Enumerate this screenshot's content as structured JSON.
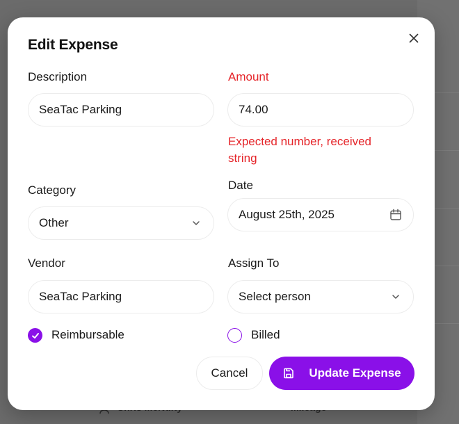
{
  "modal": {
    "title": "Edit Expense",
    "close_icon": "close-icon"
  },
  "form": {
    "description": {
      "label": "Description",
      "value": "SeaTac Parking"
    },
    "amount": {
      "label": "Amount",
      "value": "74.00",
      "error": "Expected number, received string"
    },
    "category": {
      "label": "Category",
      "value": "Other",
      "icon": "chevron-down-icon"
    },
    "date": {
      "label": "Date",
      "value": "August 25th, 2025",
      "icon": "calendar-icon"
    },
    "vendor": {
      "label": "Vendor",
      "value": "SeaTac Parking"
    },
    "assign_to": {
      "label": "Assign To",
      "value": "Select person",
      "icon": "chevron-down-icon"
    },
    "reimbursable": {
      "label": "Reimbursable",
      "checked": true
    },
    "billed": {
      "label": "Billed",
      "checked": false
    }
  },
  "actions": {
    "cancel_label": "Cancel",
    "update_label": "Update Expense",
    "update_icon": "save-icon"
  },
  "background": {
    "footer_name": "Chris McNulty",
    "footer_category": "Mileage"
  },
  "colors": {
    "accent": "#8a10e8",
    "error": "#e5252a"
  }
}
